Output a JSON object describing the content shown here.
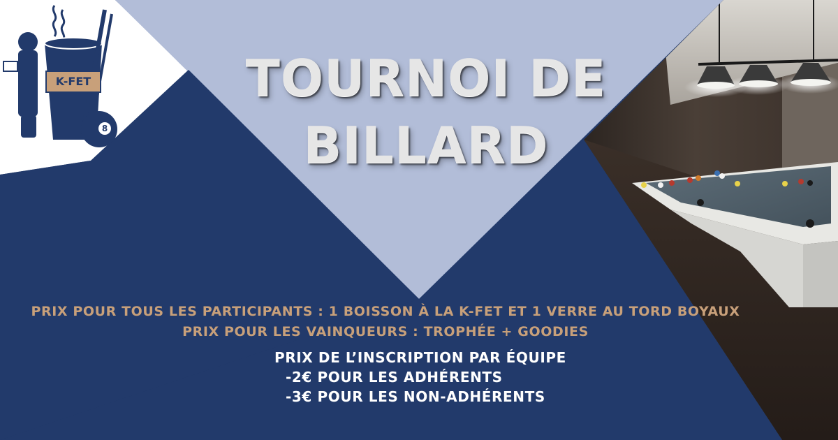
{
  "title": {
    "line1": "TOURNOI DE",
    "line2": "BILLARD"
  },
  "logo": {
    "label": "K-FET",
    "ball_number": "8",
    "icon": "kfet-logo-icon"
  },
  "prizes": {
    "participants": "PRIX POUR TOUS LES PARTICIPANTS : 1 BOISSON À LA K-FET ET 1 VERRE AU TORD BOYAUX",
    "winners": "PRIX POUR LES VAINQUEURS : TROPHÉE + GOODIES"
  },
  "registration": {
    "heading": "PRIX DE L’INSCRIPTION PAR ÉQUIPE",
    "members": "-2€ POUR LES ADHÉRENTS",
    "non_members": "-3€ POUR LES NON-ADHÉRENTS"
  },
  "colors": {
    "navy": "#223a6b",
    "light_blue": "#b2bdd8",
    "gold": "#c8a07a",
    "white": "#ffffff"
  },
  "photo": {
    "icon": "billiard-table-photo"
  }
}
